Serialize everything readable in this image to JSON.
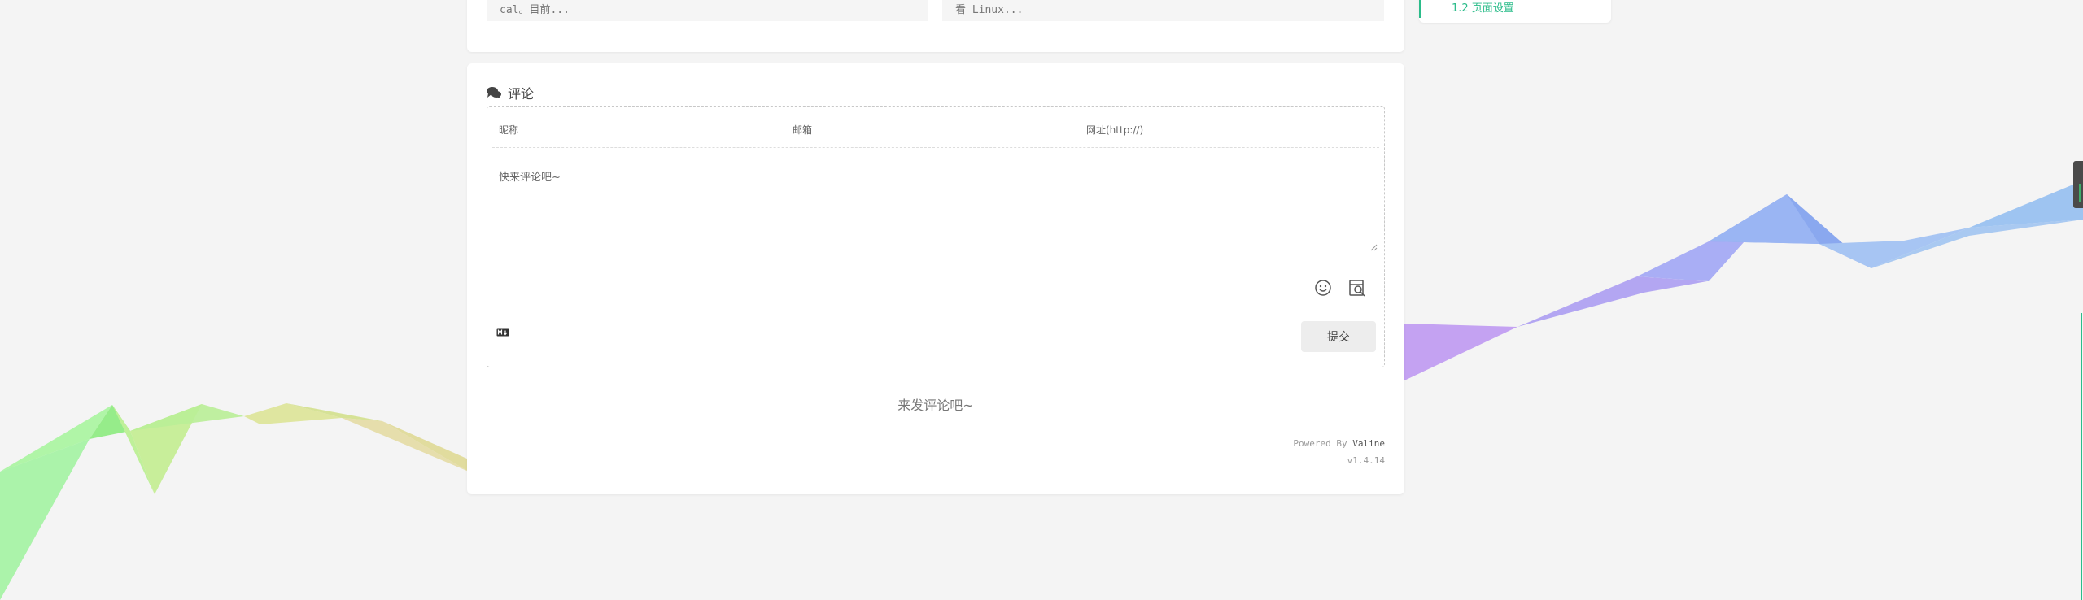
{
  "related": {
    "left_excerpt": "cal。目前...",
    "right_excerpt": "看 Linux..."
  },
  "toc": {
    "item_label": "1.2 页面设置"
  },
  "comments": {
    "title": "评论",
    "nick_placeholder": "昵称",
    "email_placeholder": "邮箱",
    "url_placeholder": "网址(http://)",
    "textarea_placeholder": "快来评论吧~",
    "submit_label": "提交",
    "empty_text": "来发评论吧~",
    "powered_by_prefix": "Powered By",
    "powered_by_name": "Valine",
    "version": "v1.4.14"
  },
  "colors": {
    "accent": "#2bbc8a",
    "background": "#f4f4f4",
    "card": "#ffffff"
  },
  "icons": [
    "comments-icon",
    "emoji-icon",
    "preview-icon",
    "markdown-icon"
  ]
}
